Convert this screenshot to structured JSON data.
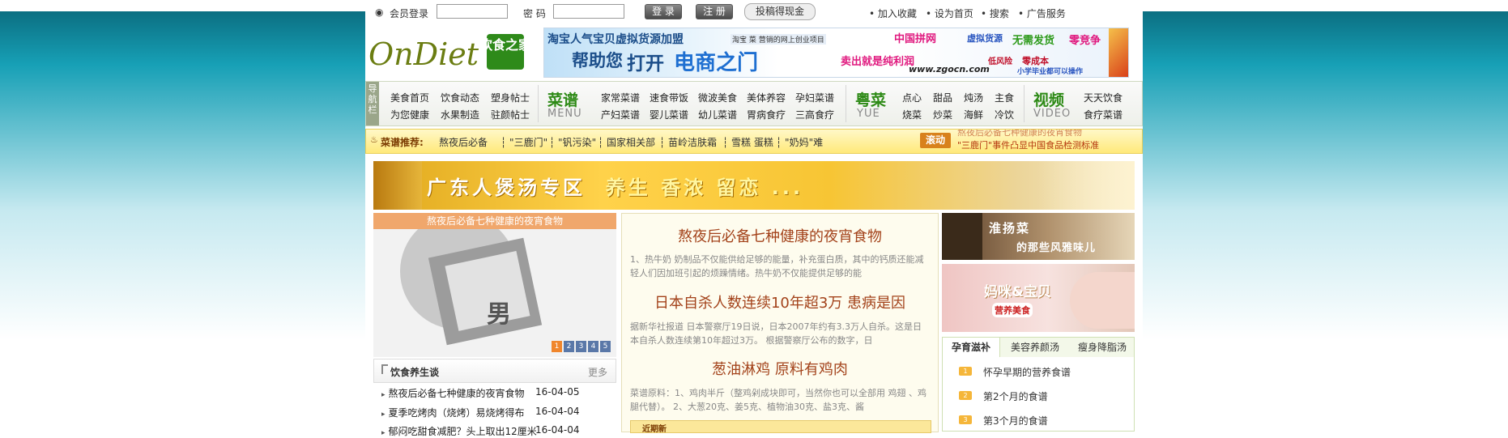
{
  "topbar": {
    "member_login": "会员登录",
    "password_label": "密 码",
    "login_button": "登 录",
    "register_button": "注 册",
    "submit_button": "投稿得现金",
    "links": [
      "加入收藏",
      "设为首页",
      "搜索",
      "广告服务"
    ]
  },
  "logo": {
    "text": "OnDiet",
    "cn": "饮食之家"
  },
  "banner_top": {
    "line1": "淘宝人气宝贝虚拟货源加盟",
    "line2_a": "帮助您",
    "line2_b": "打开",
    "line2_c": "电商之门",
    "brand": "中国拼网",
    "tag1": "虚拟货源",
    "tag2": "无需发货",
    "tag3": "零竞争",
    "sell": "卖出就是纯利润",
    "url": "www.zgocn.com",
    "low_risk": "低风险",
    "low_cost": "零成本",
    "edu": "小学毕业都可以操作",
    "tagline": "淘宝 菜 营销的网上创业项目"
  },
  "nav": {
    "side": "导航栏",
    "group1": [
      "美食首页",
      "饮食动态",
      "塑身帖士",
      "为您健康",
      "水果制造",
      "驻颜帖士"
    ],
    "recipe_title": "菜谱",
    "recipe_en": "MENU",
    "group2": [
      "家常菜谱",
      "速食带饭",
      "微波美食",
      "美体养容",
      "孕妇菜谱",
      "产妇菜谱",
      "婴儿菜谱",
      "幼儿菜谱",
      "胃病食疗",
      "三高食疗"
    ],
    "yue_title": "粤菜",
    "yue_en": "YUE",
    "group3": [
      "点心",
      "甜品",
      "炖汤",
      "主食",
      "烧菜",
      "炒菜",
      "海鲜",
      "冷饮"
    ],
    "video_title": "视频",
    "video_en": "VIDEO",
    "group4": [
      "天天饮食",
      "食疗菜谱"
    ]
  },
  "rec": {
    "label": "菜谱推荐:",
    "items": [
      "熬夜后必备",
      "\"三鹿门\"",
      "\"钒污染\"",
      "国家相关部",
      "苗岭洁肤霜",
      "雪糕 蛋糕",
      "\"奶妈\"难"
    ],
    "scroll_label": "滚动",
    "scroll_lines": [
      "熬夜后必备七种健康的夜宵食物",
      "\"三鹿门\"事件凸显中国食品检测标准"
    ]
  },
  "soup_banner": {
    "text_a": "广东人煲汤专区",
    "text_b": "养生 香浓 留恋 ..."
  },
  "slide": {
    "title": "熬夜后必备七种健康的夜宵食物",
    "pages": [
      "1",
      "2",
      "3",
      "4",
      "5"
    ],
    "badge": "男"
  },
  "diet_talk": {
    "title": "饮食养生谈",
    "more": "更多",
    "items": [
      {
        "title": "熬夜后必备七种健康的夜宵食物",
        "date": "16-04-05"
      },
      {
        "title": "夏季吃烤肉（烧烤）易烧烤得布",
        "date": "16-04-04"
      },
      {
        "title": "郁闷吃甜食减肥？头上取出12厘米",
        "date": "16-04-04"
      }
    ]
  },
  "middle": {
    "h1": "熬夜后必备七种健康的夜宵食物",
    "p1": "1、热牛奶 奶制品不仅能供给足够的能量，补充蛋白质，其中的钙质还能减轻人们因加班引起的烦躁情绪。热牛奶不仅能提供足够的能",
    "h2": "日本自杀人数连续10年超3万 患病是因",
    "p2": "据新华社报道 日本警察厅19日说，日本2007年约有3.3万人自杀。这是日本自杀人数连续第10年超过3万。 根据警察厅公布的数字，日",
    "h3": "葱油淋鸡 原料有鸡肉",
    "p3": "菜谱原料：1、鸡肉半斤（整鸡剁成块即可，当然你也可以全部用 鸡翅 、鸡腿代替）。 2、大葱20克、姜5克、植物油30克、盐3克、酱",
    "bottom": "近期新"
  },
  "right": {
    "img1_a": "淮扬菜",
    "img1_b": "的那些风雅味儿",
    "img2_a": "妈咪&宝贝",
    "img2_b": "营养美食",
    "tabs": [
      "孕育滋补",
      "美容养颜汤",
      "瘦身降脂汤"
    ],
    "list": [
      "怀孕早期的营养食谱",
      "第2个月的食谱",
      "第3个月的食谱"
    ]
  }
}
